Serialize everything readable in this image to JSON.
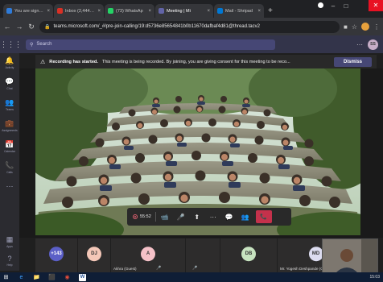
{
  "browser": {
    "tabs": [
      {
        "title": "You are signed i",
        "fav_color": "#2e7bd9",
        "active": false
      },
      {
        "title": "Inbox (2,444) - d",
        "fav_color": "#d93025",
        "active": false
      },
      {
        "title": "(73) WhatsAp",
        "fav_color": "#25d366",
        "active": false
      },
      {
        "title": "Meeting | Mi",
        "fav_color": "#6264a7",
        "active": true
      },
      {
        "title": "Mail - Shripad",
        "fav_color": "#0078d4",
        "active": false
      }
    ],
    "tab_close": "×",
    "new_tab": "+",
    "address": "teams.microsoft.com/_#/pre-join-calling/19:d5736e85654841b0b11670dafbaf4d81@thread.tacv2",
    "window_controls": {
      "minimize": "–",
      "maximize": "□",
      "close": "✕"
    },
    "nav": {
      "back": "←",
      "forward": "→",
      "reload": "↻",
      "lock": "🔒",
      "star": "☆",
      "menu": "⋮"
    }
  },
  "teams": {
    "search_placeholder": "Search",
    "more": "···",
    "user_initials": "SS",
    "rail": [
      {
        "icon": "🔔",
        "label": "Activity"
      },
      {
        "icon": "💬",
        "label": "Chat"
      },
      {
        "icon": "👥",
        "label": "Teams"
      },
      {
        "icon": "💼",
        "label": "Assignments"
      },
      {
        "icon": "📅",
        "label": "Calendar"
      },
      {
        "icon": "📞",
        "label": "Calls"
      },
      {
        "icon": "⋯",
        "label": ""
      }
    ],
    "rail_bottom": [
      {
        "icon": "▦",
        "label": "Apps"
      },
      {
        "icon": "?",
        "label": "Help"
      }
    ]
  },
  "banner": {
    "title": "Recording has started.",
    "message": "This meeting is being recorded. By joining, you are giving consent for this meeting to be reco...",
    "dismiss": "Dismiss"
  },
  "controls": {
    "timer": "55:52",
    "camera": "📹",
    "mic": "🎤",
    "share": "⬆",
    "more": "···",
    "chat": "💬",
    "people": "👥",
    "hangup": "📞"
  },
  "participants": [
    {
      "initials": "+143",
      "name": "",
      "color": "#5b5fc7",
      "text_color": "#ffffff",
      "mic": ""
    },
    {
      "initials": "DJ",
      "name": "",
      "color": "#f4c7b8",
      "text_color": "#333333",
      "mic": ""
    },
    {
      "initials": "A",
      "name": "Akhra (Guest)",
      "color": "#f5c1c8",
      "text_color": "#333333",
      "mic": "🎤"
    },
    {
      "initials": "",
      "name": "",
      "color": "",
      "text_color": "",
      "mic": "🎤"
    },
    {
      "initials": "DB",
      "name": "",
      "color": "#c7e3c0",
      "text_color": "#333333",
      "mic": ""
    },
    {
      "initials": "MD",
      "name": "Mr. Yogesh Deshpande (G...",
      "color": "#dcdcf0",
      "text_color": "#333333",
      "mic": ""
    }
  ],
  "taskbar": {
    "items": [
      "⊞",
      "e",
      "📁",
      "⬛",
      "◉",
      "W"
    ],
    "clock": "15:03"
  }
}
